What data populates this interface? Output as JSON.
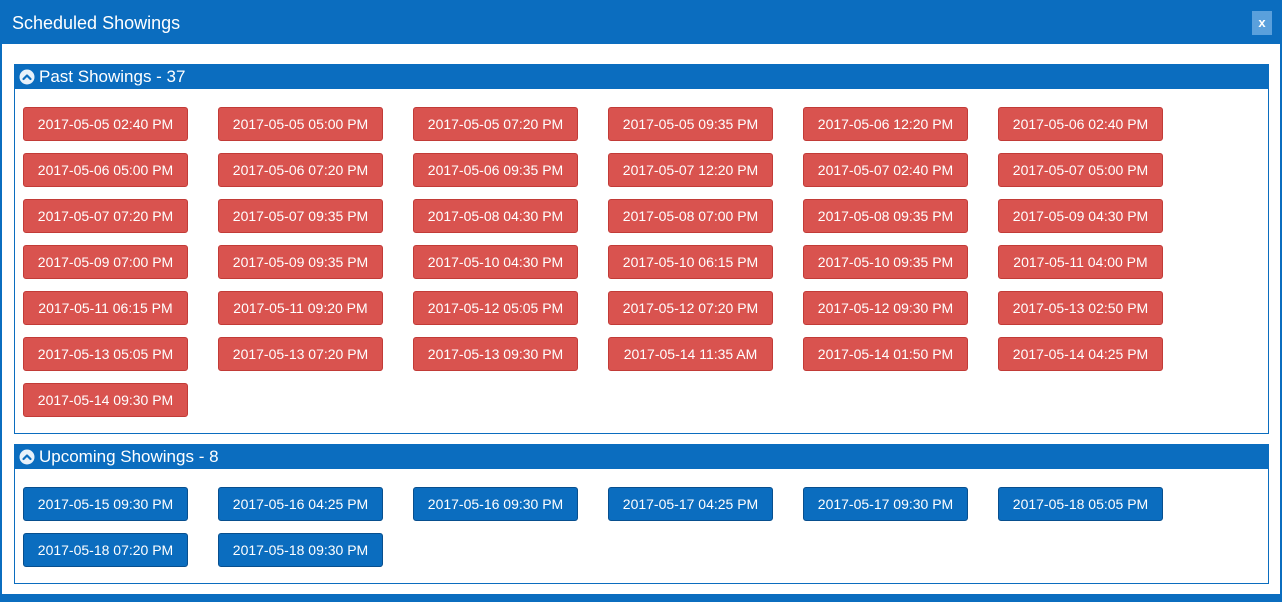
{
  "dialog": {
    "title": "Scheduled Showings",
    "close_label": "x"
  },
  "past": {
    "title": "Past Showings - 37",
    "showings": [
      "2017-05-05 02:40 PM",
      "2017-05-05 05:00 PM",
      "2017-05-05 07:20 PM",
      "2017-05-05 09:35 PM",
      "2017-05-06 12:20 PM",
      "2017-05-06 02:40 PM",
      "2017-05-06 05:00 PM",
      "2017-05-06 07:20 PM",
      "2017-05-06 09:35 PM",
      "2017-05-07 12:20 PM",
      "2017-05-07 02:40 PM",
      "2017-05-07 05:00 PM",
      "2017-05-07 07:20 PM",
      "2017-05-07 09:35 PM",
      "2017-05-08 04:30 PM",
      "2017-05-08 07:00 PM",
      "2017-05-08 09:35 PM",
      "2017-05-09 04:30 PM",
      "2017-05-09 07:00 PM",
      "2017-05-09 09:35 PM",
      "2017-05-10 04:30 PM",
      "2017-05-10 06:15 PM",
      "2017-05-10 09:35 PM",
      "2017-05-11 04:00 PM",
      "2017-05-11 06:15 PM",
      "2017-05-11 09:20 PM",
      "2017-05-12 05:05 PM",
      "2017-05-12 07:20 PM",
      "2017-05-12 09:30 PM",
      "2017-05-13 02:50 PM",
      "2017-05-13 05:05 PM",
      "2017-05-13 07:20 PM",
      "2017-05-13 09:30 PM",
      "2017-05-14 11:35 AM",
      "2017-05-14 01:50 PM",
      "2017-05-14 04:25 PM",
      "2017-05-14 09:30 PM"
    ]
  },
  "upcoming": {
    "title": "Upcoming Showings - 8",
    "showings": [
      "2017-05-15 09:30 PM",
      "2017-05-16 04:25 PM",
      "2017-05-16 09:30 PM",
      "2017-05-17 04:25 PM",
      "2017-05-17 09:30 PM",
      "2017-05-18 05:05 PM",
      "2017-05-18 07:20 PM",
      "2017-05-18 09:30 PM"
    ]
  },
  "colors": {
    "primary": "#0b6dbf",
    "past_button": "#d9534f"
  },
  "icons": {
    "section_toggle": "chevron-up-circle-icon",
    "close": "close-icon"
  }
}
